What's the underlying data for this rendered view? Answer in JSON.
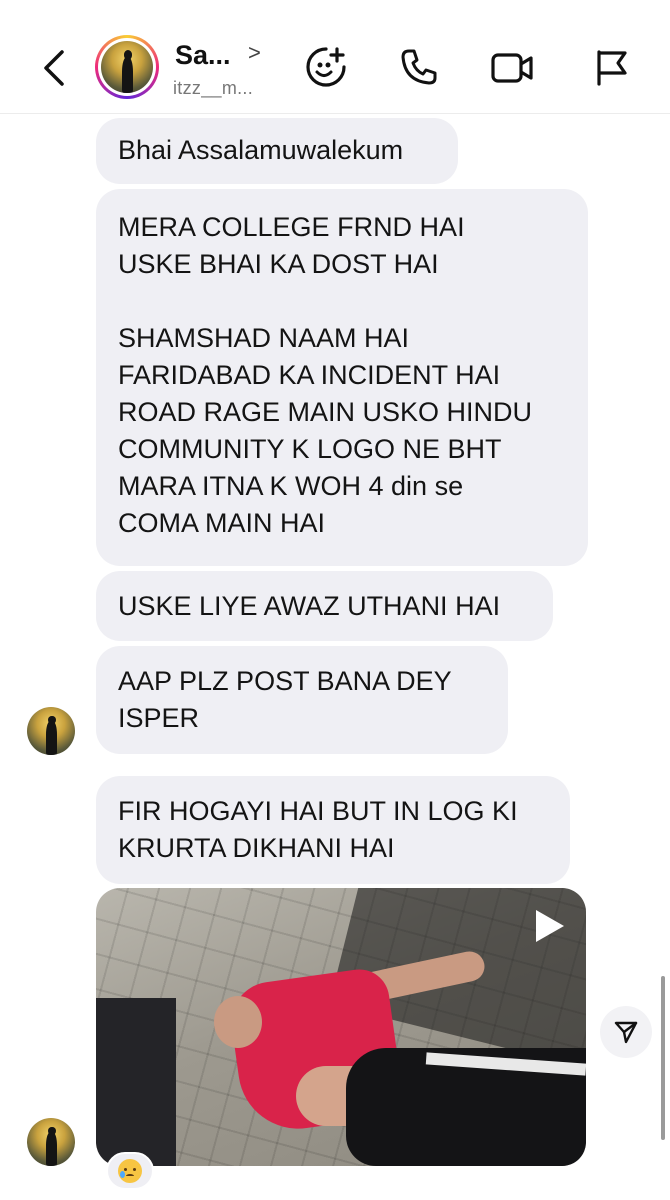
{
  "header": {
    "name": "Sa...",
    "chevron": ">",
    "username": "itzz__m..."
  },
  "icons": {
    "back": "chevron-left-icon",
    "effects": "sticker-add-icon",
    "call": "phone-icon",
    "video": "video-camera-icon",
    "report": "flag-icon",
    "play": "play-icon",
    "share": "paper-plane-icon"
  },
  "messages": [
    {
      "text": "Bhai Assalamuwalekum"
    },
    {
      "text": "MERA COLLEGE FRND HAI\nUSKE BHAI KA DOST HAI\n\nSHAMSHAD NAAM HAI\nFARIDABAD KA INCIDENT HAI\nROAD RAGE MAIN USKO HINDU\nCOMMUNITY K LOGO NE BHT\nMARA ITNA K WOH 4 din se\nCOMA MAIN HAI"
    },
    {
      "text": "USKE LIYE AWAZ UTHANI HAI"
    },
    {
      "text": "AAP PLZ POST BANA DEY\nISPER"
    },
    {
      "text": "FIR HOGAYI HAI BUT IN LOG KI\nKRURTA DIKHANI HAI"
    }
  ],
  "reaction": {
    "emoji": "crying-face"
  },
  "colors": {
    "bubble": "#efeff4",
    "story_ring": "#ee2a7b"
  }
}
